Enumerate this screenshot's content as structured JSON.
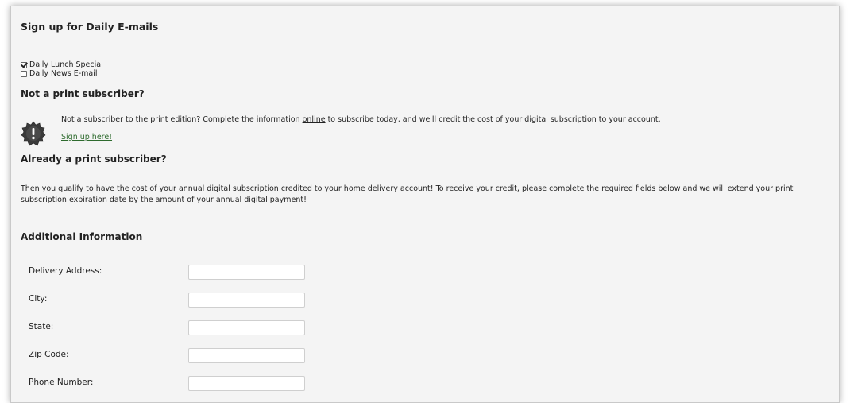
{
  "signup": {
    "title": "Sign up for Daily E-mails",
    "options": [
      {
        "label": "Daily Lunch Special",
        "checked": true
      },
      {
        "label": "Daily News E-mail",
        "checked": false
      }
    ]
  },
  "not_subscriber": {
    "heading": "Not a print subscriber?",
    "text_before": "Not a subscriber to the print edition? Complete the information ",
    "link_online": "online",
    "text_after": " to subscribe today, and we'll credit the cost of your digital subscription to your account.",
    "signup_link": "Sign up here!",
    "icon": "alert-badge-icon"
  },
  "already_subscriber": {
    "heading": "Already a print subscriber?",
    "paragraph": "Then you qualify to have the cost of your annual digital subscription credited to your home delivery account! To receive your credit, please complete the required fields below and we will extend your print subscription expiration date by the amount of your annual digital payment!"
  },
  "additional": {
    "heading": "Additional Information",
    "fields": [
      {
        "label": "Delivery Address:",
        "value": ""
      },
      {
        "label": "City:",
        "value": ""
      },
      {
        "label": "State:",
        "value": ""
      },
      {
        "label": "Zip Code:",
        "value": ""
      },
      {
        "label": "Phone Number:",
        "value": ""
      }
    ]
  }
}
